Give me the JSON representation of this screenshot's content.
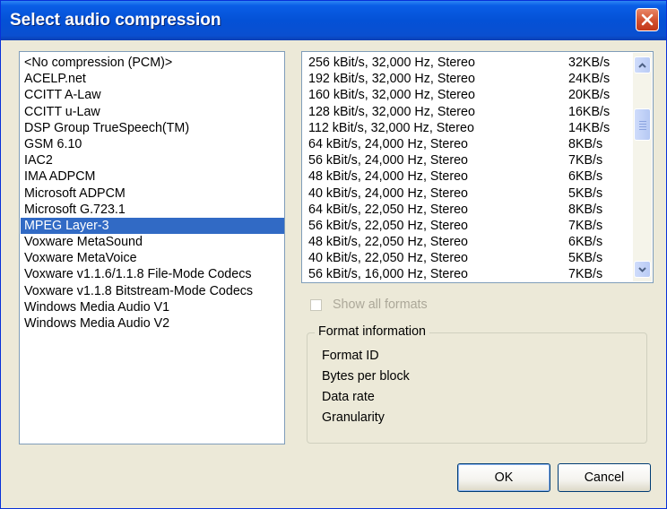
{
  "window": {
    "title": "Select audio compression"
  },
  "codec_list": {
    "items": [
      "<No compression (PCM)>",
      "ACELP.net",
      "CCITT A-Law",
      "CCITT u-Law",
      "DSP Group TrueSpeech(TM)",
      "GSM 6.10",
      "IAC2",
      "IMA ADPCM",
      "Microsoft ADPCM",
      "Microsoft G.723.1",
      "MPEG Layer-3",
      "Voxware MetaSound",
      "Voxware MetaVoice",
      "Voxware v1.1.6/1.1.8 File-Mode Codecs",
      "Voxware v1.1.8 Bitstream-Mode Codecs",
      "Windows Media Audio V1",
      "Windows Media Audio V2"
    ],
    "selected": "MPEG Layer-3"
  },
  "format_list": {
    "rows": [
      {
        "desc": "256 kBit/s, 32,000 Hz, Stereo",
        "rate": "32KB/s"
      },
      {
        "desc": "192 kBit/s, 32,000 Hz, Stereo",
        "rate": "24KB/s"
      },
      {
        "desc": "160 kBit/s, 32,000 Hz, Stereo",
        "rate": "20KB/s"
      },
      {
        "desc": "128 kBit/s, 32,000 Hz, Stereo",
        "rate": "16KB/s"
      },
      {
        "desc": "112 kBit/s, 32,000 Hz, Stereo",
        "rate": "14KB/s"
      },
      {
        "desc": "64 kBit/s, 24,000 Hz, Stereo",
        "rate": "8KB/s"
      },
      {
        "desc": "56 kBit/s, 24,000 Hz, Stereo",
        "rate": "7KB/s"
      },
      {
        "desc": "48 kBit/s, 24,000 Hz, Stereo",
        "rate": "6KB/s"
      },
      {
        "desc": "40 kBit/s, 24,000 Hz, Stereo",
        "rate": "5KB/s"
      },
      {
        "desc": "64 kBit/s, 22,050 Hz, Stereo",
        "rate": "8KB/s"
      },
      {
        "desc": "56 kBit/s, 22,050 Hz, Stereo",
        "rate": "7KB/s"
      },
      {
        "desc": "48 kBit/s, 22,050 Hz, Stereo",
        "rate": "6KB/s"
      },
      {
        "desc": "40 kBit/s, 22,050 Hz, Stereo",
        "rate": "5KB/s"
      },
      {
        "desc": "56 kBit/s, 16,000 Hz, Stereo",
        "rate": "7KB/s"
      }
    ],
    "scroll_icons": {
      "up": "chevron-up-icon",
      "down": "chevron-down-icon"
    }
  },
  "show_all_formats": {
    "label": "Show all formats",
    "checked": false,
    "enabled": false
  },
  "format_info": {
    "title": "Format information",
    "labels": [
      "Format ID",
      "Bytes per block",
      "Data rate",
      "Granularity"
    ]
  },
  "buttons": {
    "ok": "OK",
    "cancel": "Cancel"
  },
  "colors": {
    "titlebar": "#0451d6",
    "selection": "#316ac5",
    "close": "#d2502e",
    "window_bg": "#ece9d8"
  }
}
